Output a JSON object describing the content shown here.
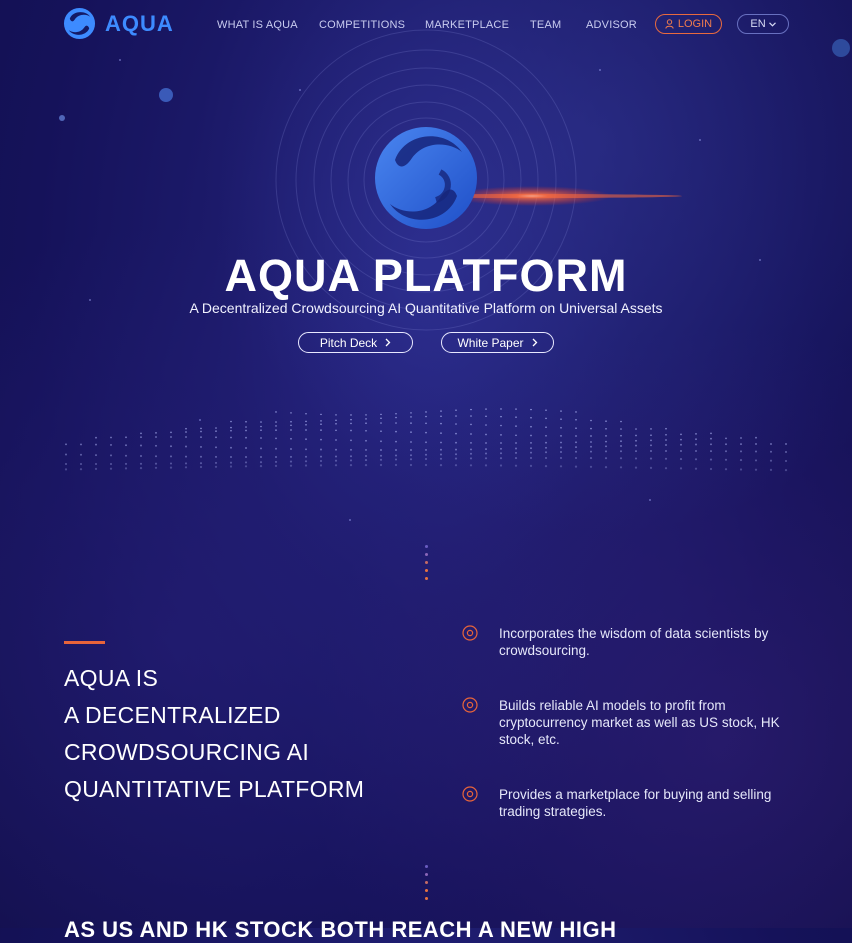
{
  "brand": {
    "name": "AQUA",
    "color": "#3d8bff"
  },
  "nav": {
    "items": [
      {
        "label": "WHAT IS AQUA"
      },
      {
        "label": "COMPETITIONS"
      },
      {
        "label": "MARKETPLACE"
      },
      {
        "label": "TEAM"
      },
      {
        "label": "ADVISOR"
      }
    ],
    "login_label": "LOGIN",
    "login_icon": "user-icon",
    "language": "EN",
    "language_icon": "chevron-down-icon"
  },
  "hero": {
    "title": "AQUA PLATFORM",
    "subtitle": "A Decentralized Crowdsourcing AI Quantitative Platform on Universal Assets",
    "buttons": [
      {
        "label": "Pitch Deck",
        "icon": "chevron-right-icon"
      },
      {
        "label": "White Paper",
        "icon": "chevron-right-icon"
      }
    ]
  },
  "about": {
    "title_lines": [
      "AQUA IS",
      "A DECENTRALIZED",
      "CROWDSOURCING AI",
      "QUANTITATIVE PLATFORM"
    ],
    "features": [
      {
        "icon": "target-circle-icon",
        "text": "Incorporates the wisdom of data scientists by crowdsourcing."
      },
      {
        "icon": "target-circle-icon",
        "text": "Builds reliable AI models to profit from cryptocurrency market as well as US stock, HK stock, etc."
      },
      {
        "icon": "target-circle-icon",
        "text": "Provides a marketplace for buying and selling trading strategies."
      }
    ]
  },
  "next_section": {
    "heading": "AS US AND HK STOCK BOTH REACH A NEW HIGH"
  },
  "colors": {
    "accent": "#e8643a",
    "background": "#1c1a6a"
  }
}
